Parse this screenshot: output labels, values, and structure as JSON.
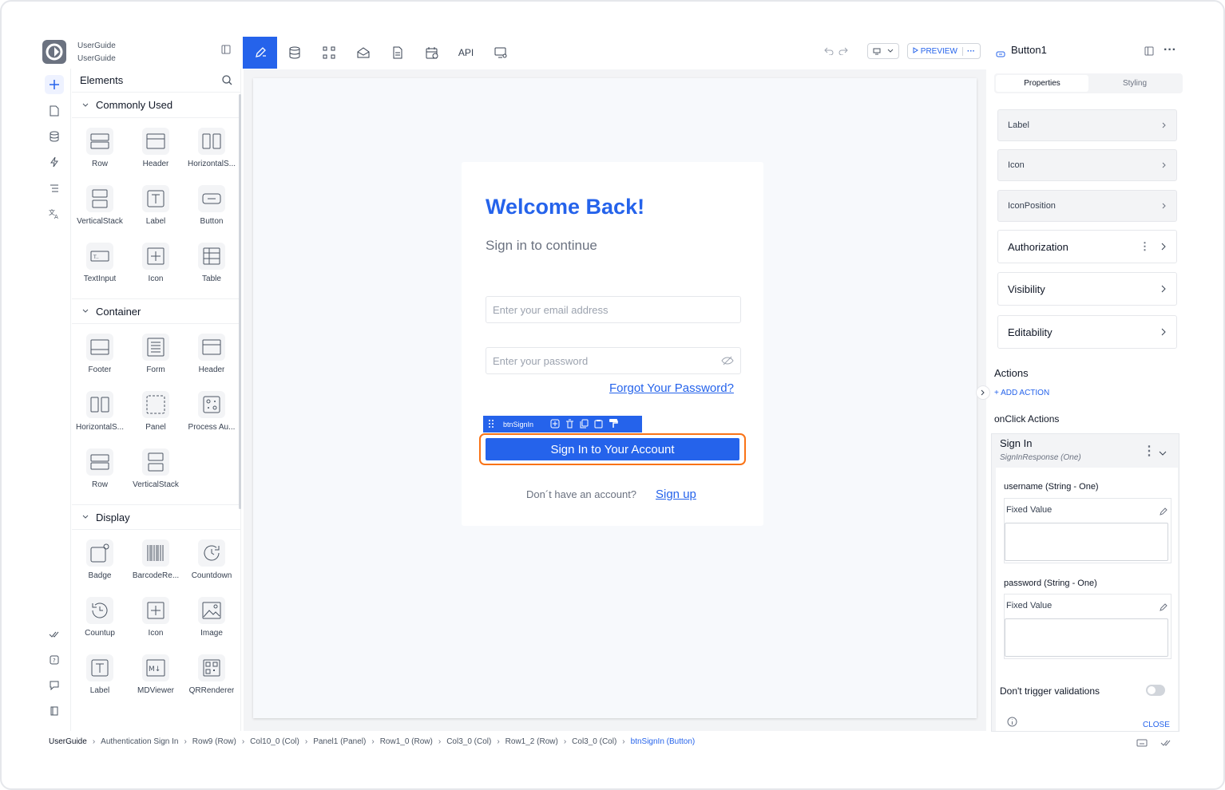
{
  "project": {
    "line1": "UserGuide",
    "line2": "UserGuide"
  },
  "elements_panel": {
    "title": "Elements",
    "sections": [
      {
        "title": "Commonly Used",
        "items": [
          "Row",
          "Header",
          "HorizontalS...",
          "VerticalStack",
          "Label",
          "Button",
          "TextInput",
          "Icon",
          "Table"
        ]
      },
      {
        "title": "Container",
        "items": [
          "Footer",
          "Form",
          "Header",
          "HorizontalS...",
          "Panel",
          "Process Au...",
          "Row",
          "VerticalStack"
        ]
      },
      {
        "title": "Display",
        "items": [
          "Badge",
          "BarcodeRe...",
          "Countdown",
          "Countup",
          "Icon",
          "Image",
          "Label",
          "MDViewer",
          "QRRenderer"
        ]
      }
    ]
  },
  "toolbar": {
    "api_label": "API",
    "preview_label": "PREVIEW"
  },
  "form": {
    "title": "Welcome Back!",
    "subtitle": "Sign in to continue",
    "email_placeholder": "Enter your email address",
    "password_placeholder": "Enter your password",
    "forgot_link": "Forgot Your Password?",
    "selected_name": "btnSignIn",
    "signin_button": "Sign In to Your Account",
    "no_account_text": "Don´t have an account?",
    "signup_link": "Sign up"
  },
  "right_panel": {
    "title": "Button1",
    "tabs": [
      "Properties",
      "Styling"
    ],
    "props": [
      "Label",
      "Icon",
      "IconPosition"
    ],
    "sections": [
      "Authorization",
      "Visibility",
      "Editability"
    ],
    "actions_title": "Actions",
    "add_action": "+ ADD ACTION",
    "onclick_title": "onClick Actions",
    "action": {
      "name": "Sign In",
      "response": "SignInResponse (One)",
      "params": [
        {
          "label": "username (String - One)",
          "mode": "Fixed Value"
        },
        {
          "label": "password (String - One)",
          "mode": "Fixed Value"
        }
      ],
      "dont_trigger": "Don't trigger validations",
      "close_label": "CLOSE"
    }
  },
  "breadcrumb": [
    "UserGuide",
    "Authentication Sign In",
    "Row9 (Row)",
    "Col10_0 (Col)",
    "Panel1 (Panel)",
    "Row1_0 (Row)",
    "Col3_0 (Col)",
    "Row1_2 (Row)",
    "Col3_0 (Col)",
    "btnSignIn (Button)"
  ],
  "colors": {
    "accent": "#2563eb",
    "selection": "#f97316"
  }
}
